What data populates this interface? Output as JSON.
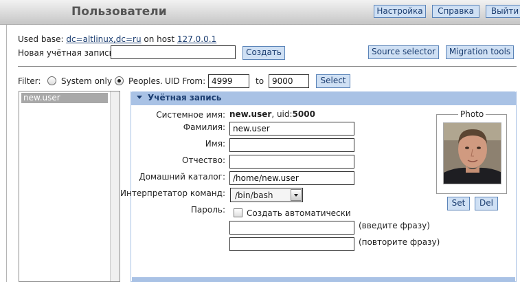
{
  "header": {
    "title": "Пользователи",
    "buttons": {
      "settings": "Настройка",
      "help": "Справка",
      "logout": "Выйти"
    }
  },
  "base": {
    "used_base_label": "Used base:",
    "base_dn": "dc=altlinux,dc=ru",
    "on_host_label": "on host",
    "host": "127.0.0.1"
  },
  "new_account": {
    "label": "Новая учётная запись:",
    "value": "",
    "create_button": "Создать"
  },
  "tools": {
    "source_selector": "Source selector",
    "migration_tools": "Migration tools"
  },
  "filter": {
    "label": "Filter:",
    "system_only": "System only",
    "peoples": "Peoples.",
    "selected": "peoples",
    "uid_from_label": "UID From:",
    "uid_from": "4999",
    "to_label": "to",
    "uid_to": "9000",
    "select_button": "Select"
  },
  "user_list": {
    "items": [
      {
        "name": "new.user",
        "selected": true
      }
    ]
  },
  "account": {
    "section_title": "Учётная запись",
    "system_name_label": "Системное имя:",
    "system_name": "new.user",
    "uid_label": ", uid:",
    "uid": "5000",
    "surname_label": "Фамилия:",
    "surname": "new.user",
    "name_label": "Имя:",
    "name": "",
    "patronymic_label": "Отчество:",
    "patronymic": "",
    "home_label": "Домашний каталог:",
    "home": "/home/new.user",
    "shell_label": "Интерпретатор команд:",
    "shell": "/bin/bash",
    "password_label": "Пароль:",
    "auto_label": "Создать автоматически",
    "auto_checked": false,
    "pass1": "",
    "pass1_hint": "(введите фразу)",
    "pass2": "",
    "pass2_hint": "(повторите фразу)"
  },
  "photo": {
    "legend": "Photo",
    "set_button": "Set",
    "del_button": "Del"
  },
  "colors": {
    "accent": "#cfe0f4",
    "border": "#5b84b8",
    "section_bar": "#a9c2e5"
  }
}
